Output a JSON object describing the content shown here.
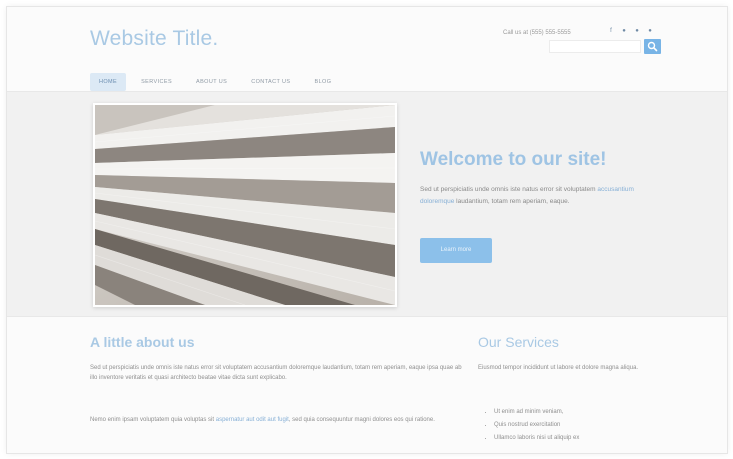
{
  "site": {
    "title": "Website Title."
  },
  "header": {
    "call_us": "Call us at (555) 555-5555",
    "social_icons": [
      "facebook-icon",
      "twitter-icon",
      "google-plus-icon",
      "rss-icon"
    ],
    "search_placeholder": "",
    "search_icon": "search-icon",
    "accent_color": "#78b4e6"
  },
  "nav": {
    "items": [
      {
        "label": "HOME",
        "active": true
      },
      {
        "label": "SERVICES",
        "active": false
      },
      {
        "label": "ABOUT US",
        "active": false
      },
      {
        "label": "CONTACT US",
        "active": false
      },
      {
        "label": "BLOG",
        "active": false
      }
    ]
  },
  "hero": {
    "heading": "Welcome to our site!",
    "text_before": "Sed ut perspiciatis unde omnis iste natus error sit voluptatem ",
    "text_link": "accusantium doloremque",
    "text_after": " laudantium, totam rem aperiam, eaque.",
    "button_label": "Learn more"
  },
  "about": {
    "heading": "A little about us",
    "paragraph1": "Sed ut perspiciatis unde omnis iste natus error sit voluptatem accusantium doloremque laudantium, totam rem aperiam, eaque ipsa quae ab illo inventore veritatis et quasi architecto beatae vitae dicta sunt explicabo.",
    "paragraph2_before": "Nemo enim ipsam voluptatem quia voluptas sit ",
    "paragraph2_link": "aspernatur aut odit aut fugit",
    "paragraph2_after": ", sed quia consequuntur magni dolores eos qui ratione."
  },
  "services": {
    "heading": "Our Services",
    "paragraph": "Eiusmod tempor incididunt ut labore et dolore magna aliqua.",
    "items": [
      "Ut enim ad minim veniam,",
      "Quis nostrud exercitation",
      "Ullamco laboris nisi ut aliquip ex"
    ]
  }
}
